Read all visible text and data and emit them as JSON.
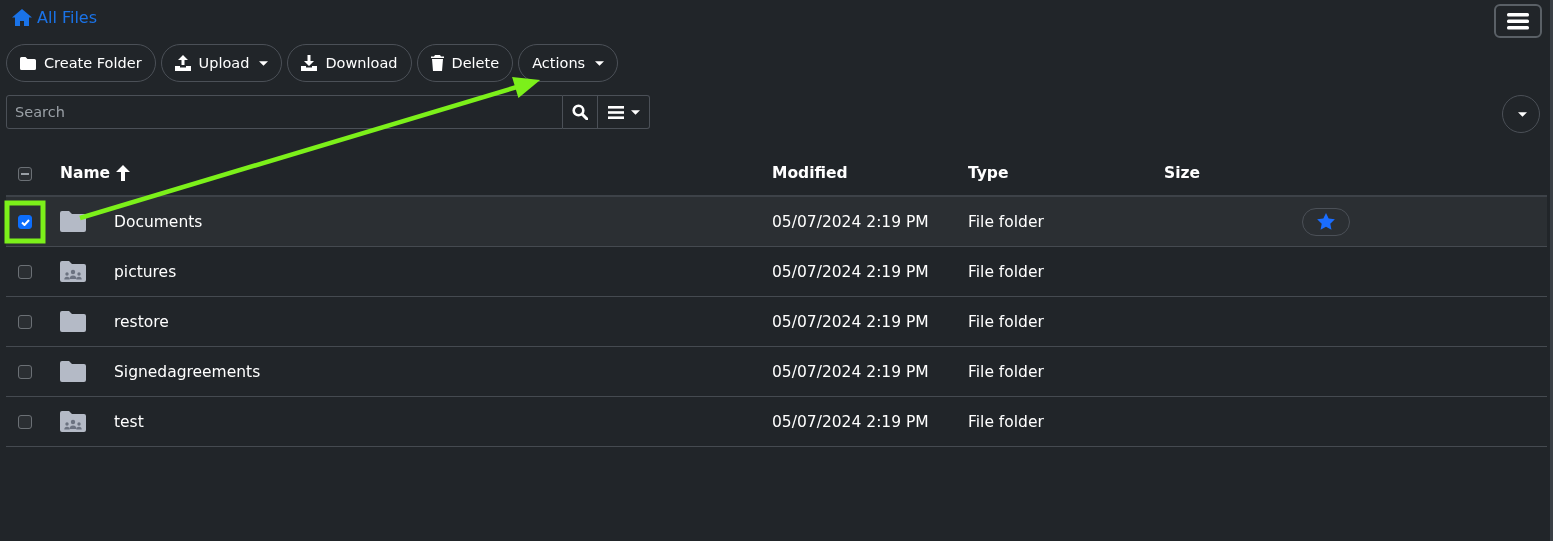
{
  "breadcrumb": {
    "label": "All Files"
  },
  "toolbar": [
    {
      "label": "Create Folder",
      "kind": "folder",
      "dropdown": false,
      "callout": false
    },
    {
      "label": "Upload",
      "kind": "upload",
      "dropdown": true,
      "callout": false
    },
    {
      "label": "Download",
      "kind": "download",
      "dropdown": false,
      "callout": false
    },
    {
      "label": "Delete",
      "kind": "trash",
      "dropdown": false,
      "callout": false
    },
    {
      "label": "Actions",
      "kind": "plain",
      "dropdown": true,
      "callout": true
    }
  ],
  "search": {
    "placeholder": "Search"
  },
  "table": {
    "select_all": {
      "indeterminate": true
    },
    "columns": [
      {
        "label": "Name",
        "sorted": true
      },
      {
        "label": "Modified",
        "sorted": false
      },
      {
        "label": "Type",
        "sorted": false
      },
      {
        "label": "Size",
        "sorted": false
      }
    ],
    "rows": [
      {
        "name": "Documents",
        "kind": "folder",
        "modified": "05/07/2024 2:19 PM",
        "type": "File folder",
        "selected": true,
        "favorite": true,
        "callout": true
      },
      {
        "name": "pictures",
        "kind": "shared",
        "modified": "05/07/2024 2:19 PM",
        "type": "File folder",
        "selected": false,
        "favorite": false,
        "callout": false
      },
      {
        "name": "restore",
        "kind": "folder",
        "modified": "05/07/2024 2:19 PM",
        "type": "File folder",
        "selected": false,
        "favorite": false,
        "callout": false
      },
      {
        "name": "Signedagreements",
        "kind": "folder",
        "modified": "05/07/2024 2:19 PM",
        "type": "File folder",
        "selected": false,
        "favorite": false,
        "callout": false
      },
      {
        "name": "test",
        "kind": "shared",
        "modified": "05/07/2024 2:19 PM",
        "type": "File folder",
        "selected": false,
        "favorite": false,
        "callout": false
      }
    ]
  }
}
